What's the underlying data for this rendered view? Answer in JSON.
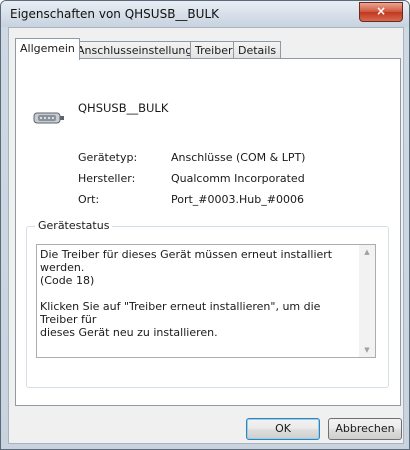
{
  "window": {
    "title": "Eigenschaften von QHSUSB__BULK",
    "close_glyph": "×"
  },
  "tabs": [
    {
      "label": "Allgemein",
      "active": true
    },
    {
      "label": "Anschlusseinstellungen",
      "active": false
    },
    {
      "label": "Treiber",
      "active": false
    },
    {
      "label": "Details",
      "active": false
    }
  ],
  "device": {
    "name": "QHSUSB__BULK",
    "icon": "serial-port-icon",
    "properties": [
      {
        "label": "Gerätetyp:",
        "value": "Anschlüsse (COM & LPT)"
      },
      {
        "label": "Hersteller:",
        "value": "Qualcomm Incorporated"
      },
      {
        "label": "Ort:",
        "value": "Port_#0003.Hub_#0006"
      }
    ]
  },
  "status": {
    "legend": "Gerätestatus",
    "line1": "Die Treiber für dieses Gerät müssen erneut installiert werden.",
    "line2": "(Code 18)",
    "line3": "Klicken Sie auf \"Treiber erneut installieren\", um die Treiber für",
    "line4": "dieses Gerät neu zu installieren."
  },
  "buttons": {
    "ok": "OK",
    "cancel": "Abbrechen"
  }
}
